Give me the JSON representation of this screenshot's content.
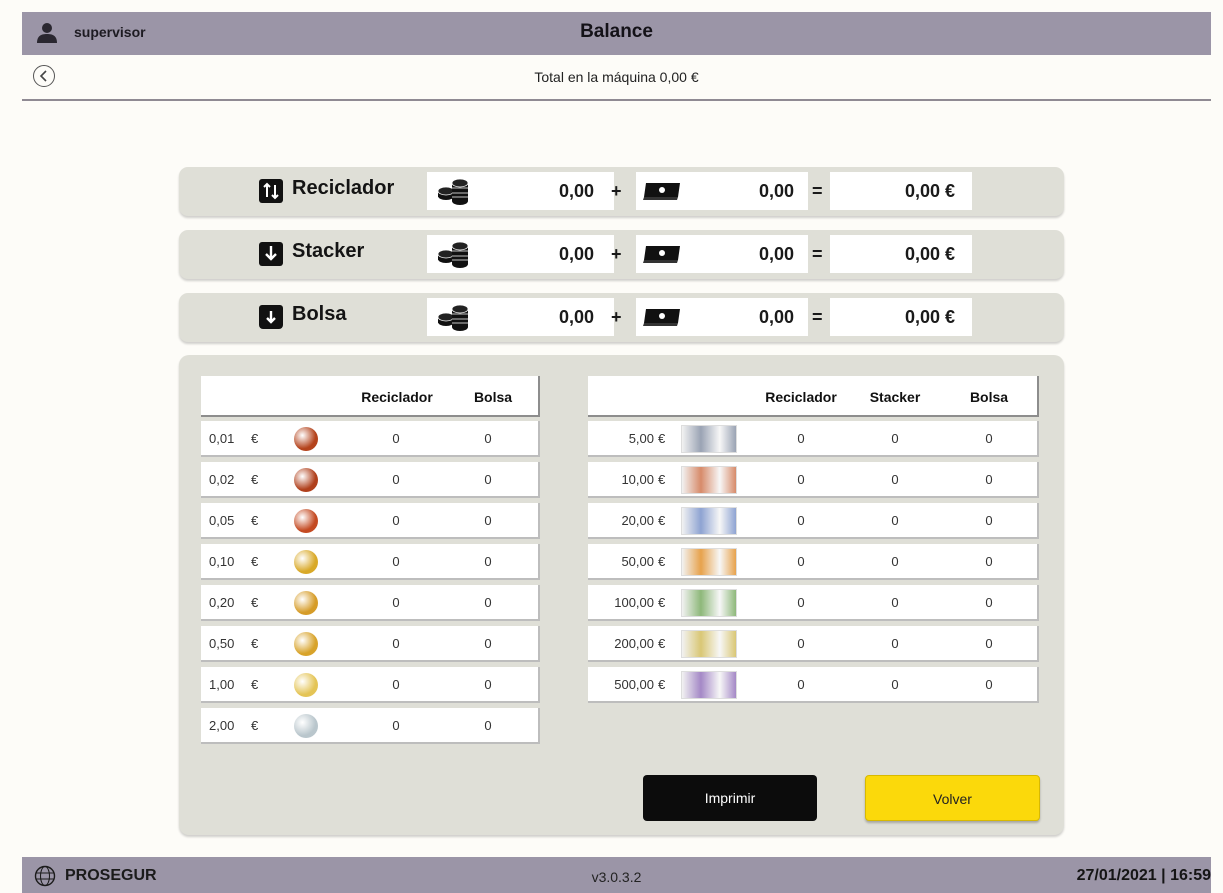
{
  "header": {
    "user": "supervisor",
    "title": "Balance"
  },
  "subheader": {
    "total_text": "Total en la máquina 0,00 €"
  },
  "summary": [
    {
      "name": "Reciclador",
      "icon": "recycler-icon",
      "coins": "0,00",
      "notes": "0,00",
      "total": "0,00 €"
    },
    {
      "name": "Stacker",
      "icon": "stacker-icon",
      "coins": "0,00",
      "notes": "0,00",
      "total": "0,00 €"
    },
    {
      "name": "Bolsa",
      "icon": "bag-icon",
      "coins": "0,00",
      "notes": "0,00",
      "total": "0,00 €"
    }
  ],
  "symbols": {
    "plus": "+",
    "equals": "="
  },
  "coins_table": {
    "headers": [
      "Reciclador",
      "Bolsa"
    ],
    "currency": "€",
    "rows": [
      {
        "value": "0,01",
        "reciclador": "0",
        "bolsa": "0",
        "color": "#b4431c"
      },
      {
        "value": "0,02",
        "reciclador": "0",
        "bolsa": "0",
        "color": "#b0401c"
      },
      {
        "value": "0,05",
        "reciclador": "0",
        "bolsa": "0",
        "color": "#c44a22"
      },
      {
        "value": "0,10",
        "reciclador": "0",
        "bolsa": "0",
        "color": "#d9a928"
      },
      {
        "value": "0,20",
        "reciclador": "0",
        "bolsa": "0",
        "color": "#d69c28"
      },
      {
        "value": "0,50",
        "reciclador": "0",
        "bolsa": "0",
        "color": "#d8a32a"
      },
      {
        "value": "1,00",
        "reciclador": "0",
        "bolsa": "0",
        "color": "#e4c455"
      },
      {
        "value": "2,00",
        "reciclador": "0",
        "bolsa": "0",
        "color": "#b9c6cc"
      }
    ]
  },
  "notes_table": {
    "headers": [
      "Reciclador",
      "Stacker",
      "Bolsa"
    ],
    "currency": "€",
    "rows": [
      {
        "value": "5,00",
        "reciclador": "0",
        "stacker": "0",
        "bolsa": "0",
        "color": "#9aa3b4"
      },
      {
        "value": "10,00",
        "reciclador": "0",
        "stacker": "0",
        "bolsa": "0",
        "color": "#d78b6a"
      },
      {
        "value": "20,00",
        "reciclador": "0",
        "stacker": "0",
        "bolsa": "0",
        "color": "#8ea3d2"
      },
      {
        "value": "50,00",
        "reciclador": "0",
        "stacker": "0",
        "bolsa": "0",
        "color": "#e7a24c"
      },
      {
        "value": "100,00",
        "reciclador": "0",
        "stacker": "0",
        "bolsa": "0",
        "color": "#8eb87a"
      },
      {
        "value": "200,00",
        "reciclador": "0",
        "stacker": "0",
        "bolsa": "0",
        "color": "#d9c775"
      },
      {
        "value": "500,00",
        "reciclador": "0",
        "stacker": "0",
        "bolsa": "0",
        "color": "#a488c6"
      }
    ]
  },
  "buttons": {
    "print": "Imprimir",
    "back": "Volver"
  },
  "footer": {
    "brand": "PROSEGUR",
    "version": "v3.0.3.2",
    "datetime": "27/01/2021 | 16:59"
  }
}
